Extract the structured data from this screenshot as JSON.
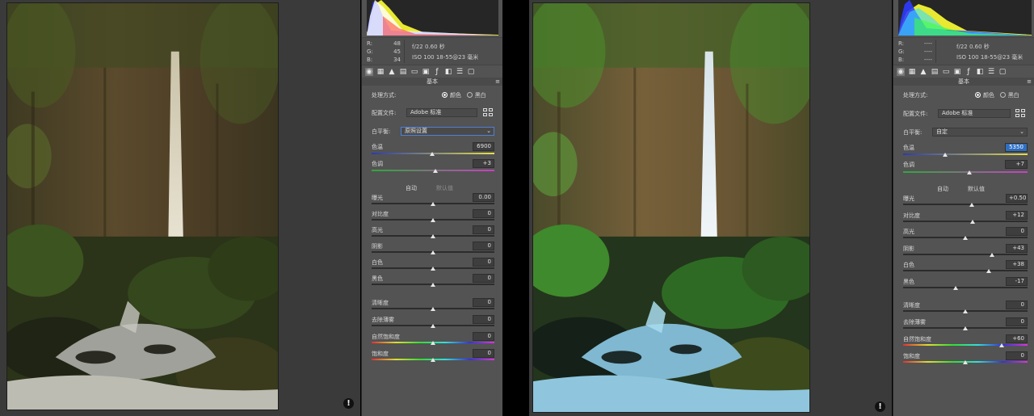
{
  "before": {
    "rgb": {
      "r_label": "R:",
      "r": "48",
      "g_label": "G:",
      "g": "45",
      "b_label": "B:",
      "b": "34"
    },
    "camera": {
      "line1": "f/22   0.60 秒",
      "line2": "ISO 100   18-55@23 毫米"
    },
    "section_title": "基本",
    "process_label": "处理方式:",
    "process_color": "颜色",
    "process_bw": "黑白",
    "profile_label": "配置文件:",
    "profile_value": "Adobe 标准",
    "wb_label": "白平衡:",
    "wb_value": "原照设置",
    "temp_label": "色温",
    "temp_value": "6900",
    "tint_label": "色调",
    "tint_value": "+3",
    "auto_label": "自动",
    "default_label": "默认值",
    "sliders": [
      {
        "label": "曝光",
        "value": "0.00"
      },
      {
        "label": "对比度",
        "value": "0"
      },
      {
        "label": "高光",
        "value": "0"
      },
      {
        "label": "阴影",
        "value": "0"
      },
      {
        "label": "白色",
        "value": "0"
      },
      {
        "label": "黑色",
        "value": "0"
      }
    ],
    "presence": [
      {
        "label": "清晰度",
        "value": "0"
      },
      {
        "label": "去除薄雾",
        "value": "0"
      },
      {
        "label": "自然饱和度",
        "value": "0"
      },
      {
        "label": "饱和度",
        "value": "0"
      }
    ]
  },
  "after": {
    "rgb": {
      "r_label": "R:",
      "r": "----",
      "g_label": "G:",
      "g": "----",
      "b_label": "B:",
      "b": "----"
    },
    "camera": {
      "line1": "f/22   0.60 秒",
      "line2": "ISO 100   18-55@23 毫米"
    },
    "section_title": "基本",
    "process_label": "处理方式:",
    "process_color": "颜色",
    "process_bw": "黑白",
    "profile_label": "配置文件:",
    "profile_value": "Adobe 标准",
    "wb_label": "白平衡:",
    "wb_value": "自定",
    "temp_label": "色温",
    "temp_value": "5350",
    "tint_label": "色调",
    "tint_value": "+7",
    "auto_label": "自动",
    "default_label": "默认值",
    "sliders": [
      {
        "label": "曝光",
        "value": "+0.50"
      },
      {
        "label": "对比度",
        "value": "+12"
      },
      {
        "label": "高光",
        "value": "0"
      },
      {
        "label": "阴影",
        "value": "+43"
      },
      {
        "label": "白色",
        "value": "+38"
      },
      {
        "label": "黑色",
        "value": "-17"
      }
    ],
    "presence": [
      {
        "label": "清晰度",
        "value": "0"
      },
      {
        "label": "去除薄雾",
        "value": "0"
      },
      {
        "label": "自然饱和度",
        "value": "+60"
      },
      {
        "label": "饱和度",
        "value": "0"
      }
    ]
  },
  "tabs": [
    "basic-icon",
    "tone-curve-icon",
    "detail-icon",
    "hsl-icon",
    "split-toning-icon",
    "lens-icon",
    "fx-icon",
    "calibration-icon",
    "presets-icon",
    "snapshots-icon"
  ],
  "warning_glyph": "!",
  "menu_glyph": "≡",
  "chevron_glyph": "⌄",
  "colors": {
    "accent": "#2f6fc2",
    "panel": "#535353",
    "canvas": "#3a3a3a"
  }
}
